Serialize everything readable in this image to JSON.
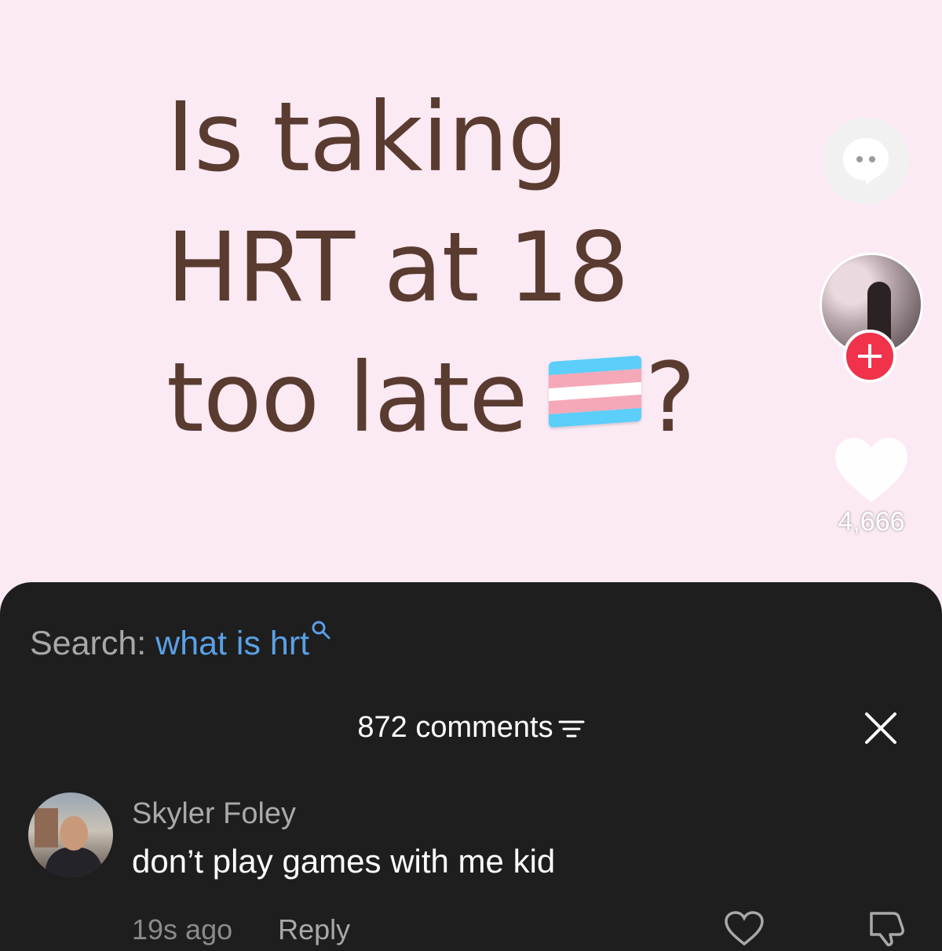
{
  "video": {
    "caption_lines": [
      "Is taking",
      "HRT at 18",
      "too late"
    ],
    "caption_end": "?",
    "flag_colors": [
      "#5bcefa",
      "#f5a9b8",
      "#ffffff",
      "#f5a9b8",
      "#5bcefa"
    ],
    "caption_color": "#5a3b30",
    "background": "#fbe9f3"
  },
  "rail": {
    "like_count": "4,666",
    "follow_symbol": "+",
    "icons": [
      "chat-bubble-icon",
      "heart-icon",
      "plus-icon"
    ]
  },
  "comments": {
    "search_label": "Search:",
    "search_term": "what is hrt",
    "title": "872 comments",
    "items": [
      {
        "username": "Skyler Foley",
        "text": "don’t play games with me kid",
        "time": "19s ago",
        "reply_label": "Reply"
      }
    ]
  }
}
